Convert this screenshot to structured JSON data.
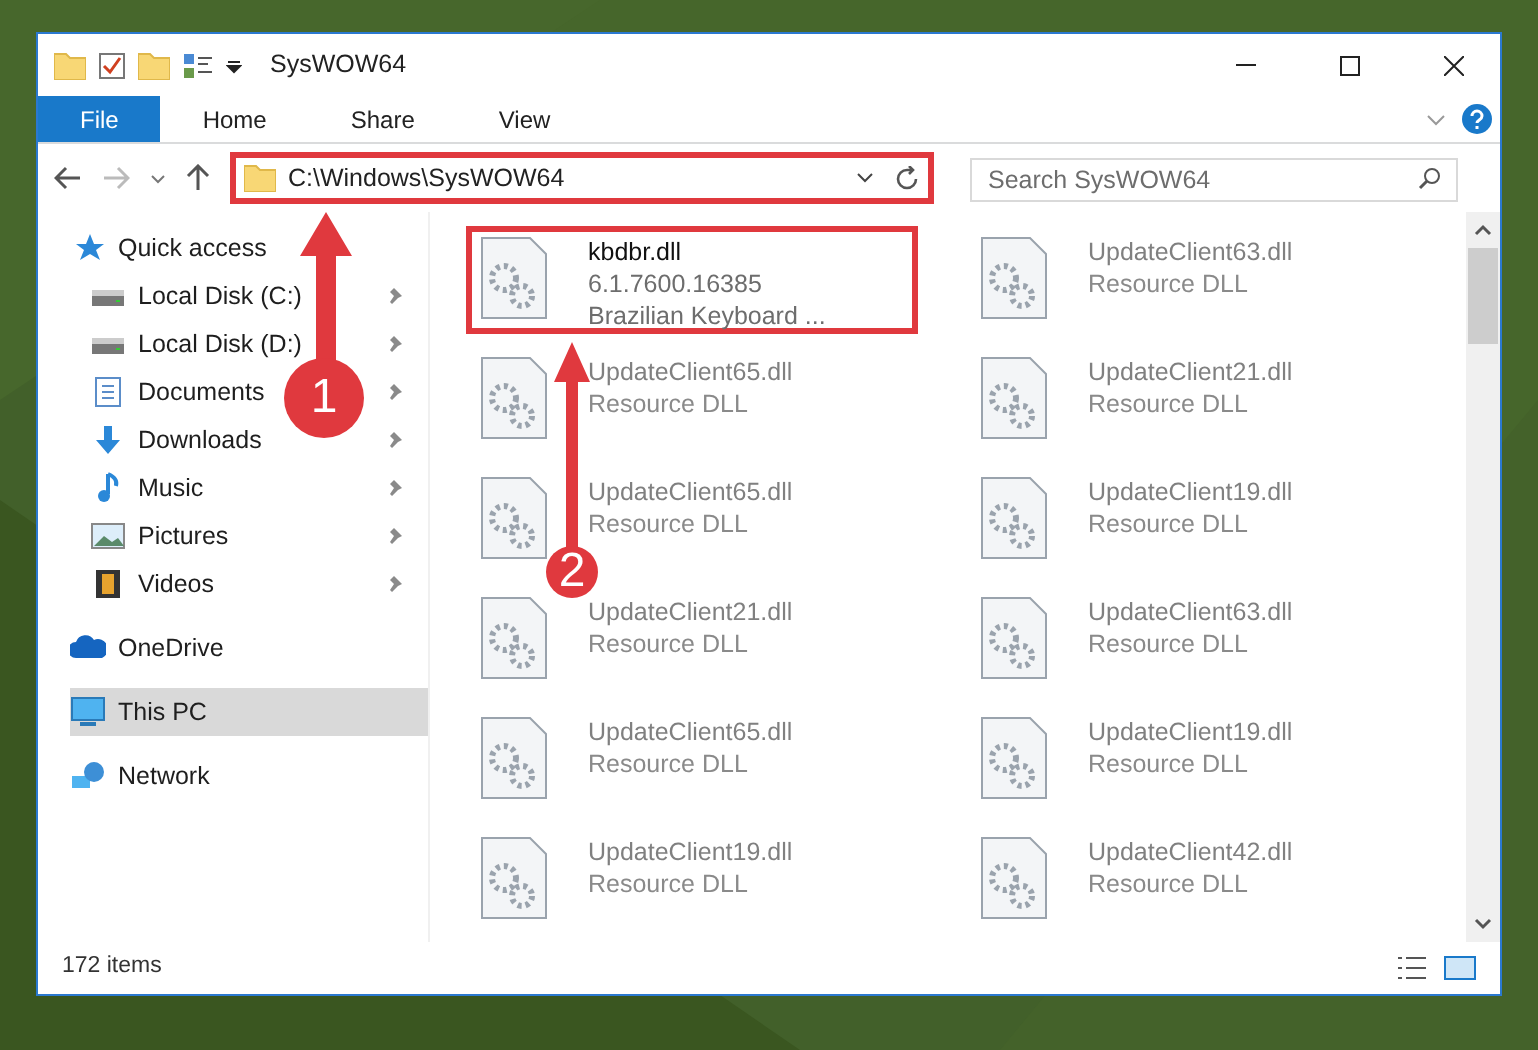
{
  "window": {
    "title": "SysWOW64"
  },
  "ribbon_tabs": [
    {
      "label": "File",
      "selected": true
    },
    {
      "label": "Home",
      "selected": false
    },
    {
      "label": "Share",
      "selected": false
    },
    {
      "label": "View",
      "selected": false
    }
  ],
  "address_bar": {
    "path": "C:\\Windows\\SysWOW64",
    "highlighted": true
  },
  "search": {
    "placeholder": "Search SysWOW64"
  },
  "sidebar": {
    "items": [
      {
        "label": "Quick access",
        "kind": "star",
        "selected": false,
        "children": [
          {
            "label": "Local Disk (C:)",
            "kind": "drive",
            "pinned": true,
            "selected": false
          },
          {
            "label": "Local Disk (D:)",
            "kind": "drive",
            "pinned": true,
            "selected": false
          },
          {
            "label": "Documents",
            "kind": "document",
            "pinned": true,
            "selected": false
          },
          {
            "label": "Downloads",
            "kind": "download",
            "pinned": true,
            "selected": false
          },
          {
            "label": "Music",
            "kind": "music",
            "pinned": true,
            "selected": false
          },
          {
            "label": "Pictures",
            "kind": "pictures",
            "pinned": true,
            "selected": false
          },
          {
            "label": "Videos",
            "kind": "videos",
            "pinned": true,
            "selected": false
          }
        ]
      },
      {
        "label": "OneDrive",
        "kind": "cloud",
        "selected": false
      },
      {
        "label": "This PC",
        "kind": "pc",
        "selected": true
      },
      {
        "label": "Network",
        "kind": "network",
        "selected": false
      }
    ]
  },
  "files": [
    {
      "name": "kbdbr.dll",
      "lines": [
        "6.1.7600.16385",
        "Brazilian Keyboard ..."
      ],
      "blurred": false,
      "highlighted": true
    },
    {
      "name": "UpdateClient63.dll",
      "lines": [
        "Resource DLL"
      ],
      "blurred": true,
      "highlighted": false
    },
    {
      "name": "UpdateClient65.dll",
      "lines": [
        "Resource DLL"
      ],
      "blurred": true,
      "highlighted": false
    },
    {
      "name": "UpdateClient21.dll",
      "lines": [
        "Resource DLL"
      ],
      "blurred": true,
      "highlighted": false
    },
    {
      "name": "UpdateClient65.dll",
      "lines": [
        "Resource DLL"
      ],
      "blurred": true,
      "highlighted": false
    },
    {
      "name": "UpdateClient19.dll",
      "lines": [
        "Resource DLL"
      ],
      "blurred": true,
      "highlighted": false
    },
    {
      "name": "UpdateClient21.dll",
      "lines": [
        "Resource DLL"
      ],
      "blurred": true,
      "highlighted": false
    },
    {
      "name": "UpdateClient63.dll",
      "lines": [
        "Resource DLL"
      ],
      "blurred": true,
      "highlighted": false
    },
    {
      "name": "UpdateClient65.dll",
      "lines": [
        "Resource DLL"
      ],
      "blurred": true,
      "highlighted": false
    },
    {
      "name": "UpdateClient19.dll",
      "lines": [
        "Resource DLL"
      ],
      "blurred": true,
      "highlighted": false
    },
    {
      "name": "UpdateClient19.dll",
      "lines": [
        "Resource DLL"
      ],
      "blurred": true,
      "highlighted": false
    },
    {
      "name": "UpdateClient42.dll",
      "lines": [
        "Resource DLL"
      ],
      "blurred": true,
      "highlighted": false
    }
  ],
  "status_bar": {
    "item_count": "172 items"
  },
  "annotations": [
    {
      "number": "1"
    },
    {
      "number": "2"
    }
  ]
}
